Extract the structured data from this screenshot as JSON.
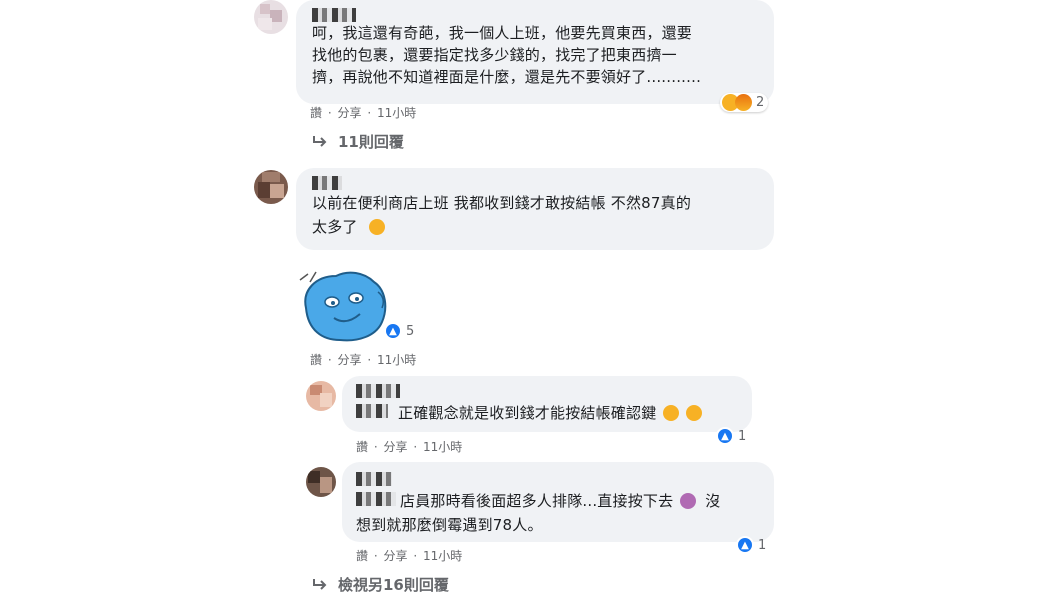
{
  "comments": [
    {
      "text_lines": [
        "呵，我這還有奇葩，我一個人上班，他要先買東西，還要",
        "找他的包裹，還要指定找多少錢的，找完了把東西擠一",
        "擠，再說他不知道裡面是什麼，還是先不要領好了..........."
      ],
      "actions": [
        "讚",
        "·",
        "分享",
        "·",
        "11小時"
      ],
      "reaction_count": "2",
      "replies_label": "11則回覆"
    },
    {
      "text_lines": [
        "以前在便利商店上班 我都收到錢才敢按結帳 不然87真的",
        "太多了"
      ],
      "sticker_reaction_count": "5",
      "actions": [
        "讚",
        "·",
        "分享",
        "·",
        "11小時"
      ],
      "replies": [
        {
          "text_lines": [
            "正確觀念就是收到錢才能按結帳確認鍵"
          ],
          "reaction_count": "1",
          "actions": [
            "讚",
            "·",
            "分享",
            "·",
            "11小時"
          ]
        },
        {
          "text_lines": [
            "店員那時看後面超多人排隊...直接按下去",
            "沒",
            "想到就那麼倒霉遇到78人。"
          ],
          "reaction_count": "1",
          "actions": [
            "讚",
            "·",
            "分享",
            "·",
            "11小時"
          ]
        }
      ],
      "more_replies_label": "檢視另16則回覆"
    }
  ],
  "colors": {
    "bubble": "#f0f2f5",
    "meta_text": "#65676b",
    "like_blue": "#1877f2",
    "sticker_blue": "#4aa8e8"
  },
  "icons": {
    "reply_arrow": "reply-arrow-icon",
    "like": "like-reaction-icon",
    "sad": "sad-emoji-icon",
    "angry": "angry-emoji-icon",
    "laugh": "laugh-emoji-icon",
    "sticker": "blue-creature-sticker"
  }
}
